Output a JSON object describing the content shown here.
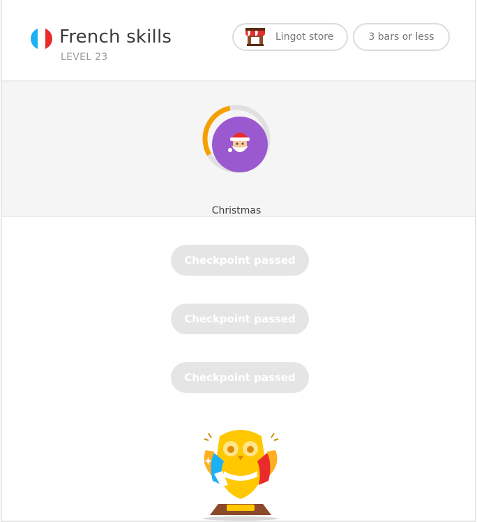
{
  "header": {
    "title": "French skills",
    "level": "LEVEL 23",
    "flag_colors": [
      "#1cb0f6",
      "#ffffff",
      "#ea2b2b"
    ],
    "lingot_store_label": "Lingot store",
    "bars_label": "3 bars or less"
  },
  "skill": {
    "name": "Christmas",
    "icon": "santa-icon",
    "circle_color": "#9b59d0",
    "progress_fraction": 0.3,
    "progress_color": "#f6a000"
  },
  "checkpoints": [
    {
      "label": "Checkpoint passed"
    },
    {
      "label": "Checkpoint passed"
    },
    {
      "label": "Checkpoint passed"
    }
  ],
  "trophy": {
    "icon": "golden-owl-trophy-icon"
  },
  "colors": {
    "section_bg": "#f5f5f5",
    "checkpoint_bg": "#e5e5e5",
    "gold": "#ffc800"
  }
}
